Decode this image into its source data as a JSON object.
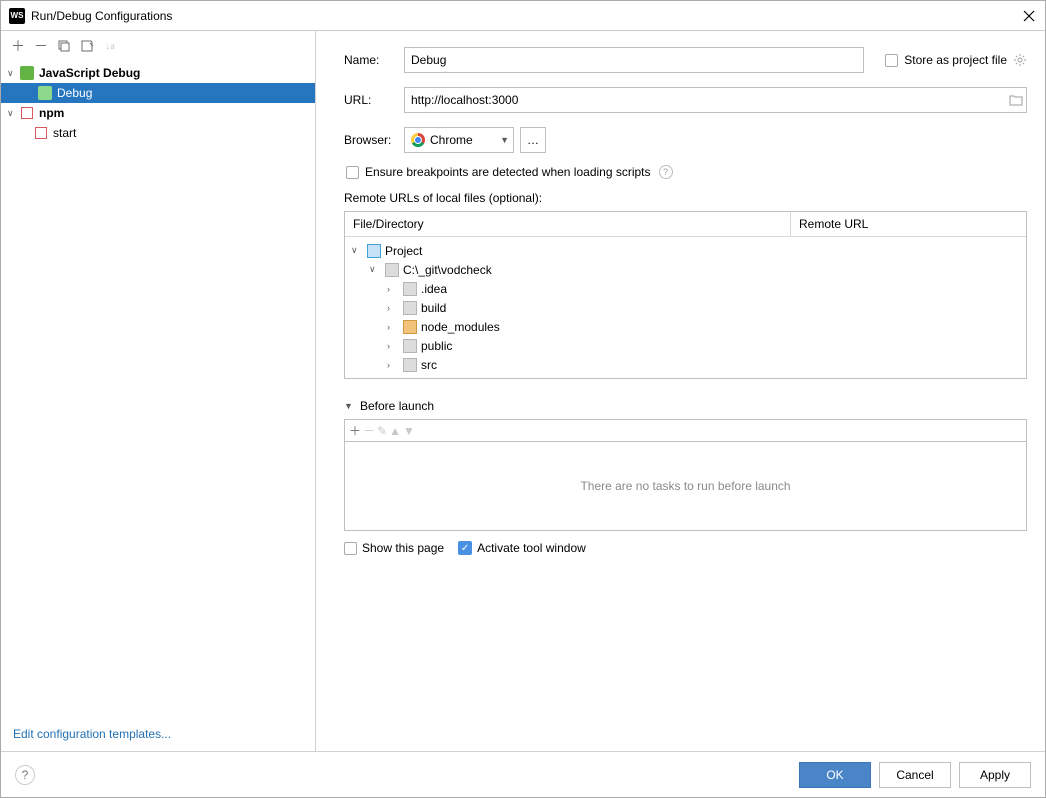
{
  "title": "Run/Debug Configurations",
  "sidebar": {
    "groups": [
      {
        "label": "JavaScript Debug",
        "icon": "js",
        "children": [
          {
            "label": "Debug",
            "selected": true
          }
        ]
      },
      {
        "label": "npm",
        "icon": "npm",
        "children": [
          {
            "label": "start"
          }
        ]
      }
    ],
    "templates_link": "Edit configuration templates..."
  },
  "form": {
    "name_label": "Name:",
    "name_value": "Debug",
    "store_label": "Store as project file",
    "url_label": "URL:",
    "url_value": "http://localhost:3000",
    "browser_label": "Browser:",
    "browser_value": "Chrome",
    "ensure_label": "Ensure breakpoints are detected when loading scripts",
    "remote_label": "Remote URLs of local files (optional):",
    "col_file": "File/Directory",
    "col_url": "Remote URL",
    "tree": {
      "root": "Project",
      "path": "C:\\_git\\vodcheck",
      "folders": [
        {
          "name": ".idea",
          "orange": false
        },
        {
          "name": "build",
          "orange": false
        },
        {
          "name": "node_modules",
          "orange": true
        },
        {
          "name": "public",
          "orange": false
        },
        {
          "name": "src",
          "orange": false
        }
      ]
    }
  },
  "before_launch": {
    "title": "Before launch",
    "empty_text": "There are no tasks to run before launch"
  },
  "options": {
    "show_page": "Show this page",
    "activate": "Activate tool window"
  },
  "buttons": {
    "ok": "OK",
    "cancel": "Cancel",
    "apply": "Apply"
  }
}
